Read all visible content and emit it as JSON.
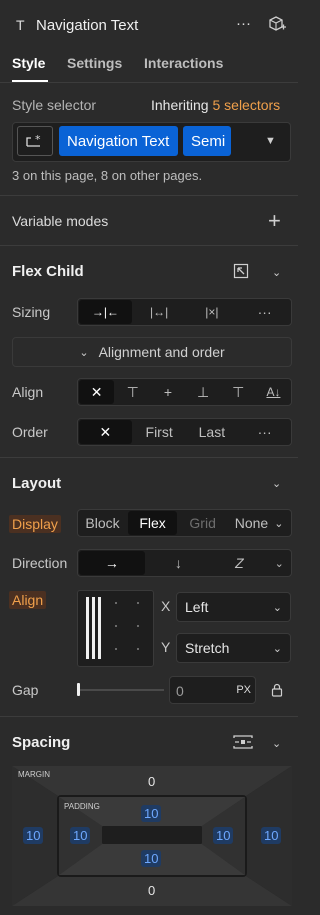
{
  "header": {
    "element_type_glyph": "T",
    "title": "Navigation Text",
    "more_glyph": "···"
  },
  "tabs": [
    {
      "label": "Style",
      "active": true
    },
    {
      "label": "Settings",
      "active": false
    },
    {
      "label": "Interactions",
      "active": false
    }
  ],
  "style_selector": {
    "label": "Style selector",
    "inheriting_label": "Inheriting",
    "inheriting_count": "5 selectors",
    "chips": [
      "Navigation Text",
      "Semi"
    ],
    "usage_text": "3 on this page, 8 on other pages."
  },
  "variable_modes": {
    "label": "Variable modes",
    "add_glyph": "+"
  },
  "flex_child": {
    "title": "Flex Child",
    "sizing_label": "Sizing",
    "sizing_options": [
      "→|←",
      "|↔|",
      "|×|",
      "···"
    ],
    "alignment_toggle": "Alignment and order",
    "align_label": "Align",
    "align_options": [
      "✕",
      "⊤",
      "+",
      "⊥",
      "⊤",
      "A↓"
    ],
    "order_label": "Order",
    "order_options": [
      "✕",
      "First",
      "Last",
      "···"
    ]
  },
  "layout": {
    "title": "Layout",
    "display_label": "Display",
    "display_options": [
      "Block",
      "Flex",
      "Grid",
      "None"
    ],
    "display_selected": "Flex",
    "direction_label": "Direction",
    "direction_options": [
      "→",
      "↓",
      "Z"
    ],
    "align_label": "Align",
    "x_label": "X",
    "x_value": "Left",
    "y_label": "Y",
    "y_value": "Stretch",
    "gap_label": "Gap",
    "gap_value": "0",
    "gap_unit": "PX"
  },
  "spacing": {
    "title": "Spacing",
    "margin_label": "MARGIN",
    "padding_label": "PADDING",
    "margin": {
      "top": "0",
      "bottom": "0",
      "left": "10",
      "right": "10"
    },
    "padding": {
      "top": "10",
      "bottom": "10",
      "left": "10",
      "right": "10"
    }
  },
  "colors": {
    "accent_blue": "#0a63d6",
    "warning_orange": "#f0a04b",
    "panel_bg": "#2b2b2b"
  }
}
